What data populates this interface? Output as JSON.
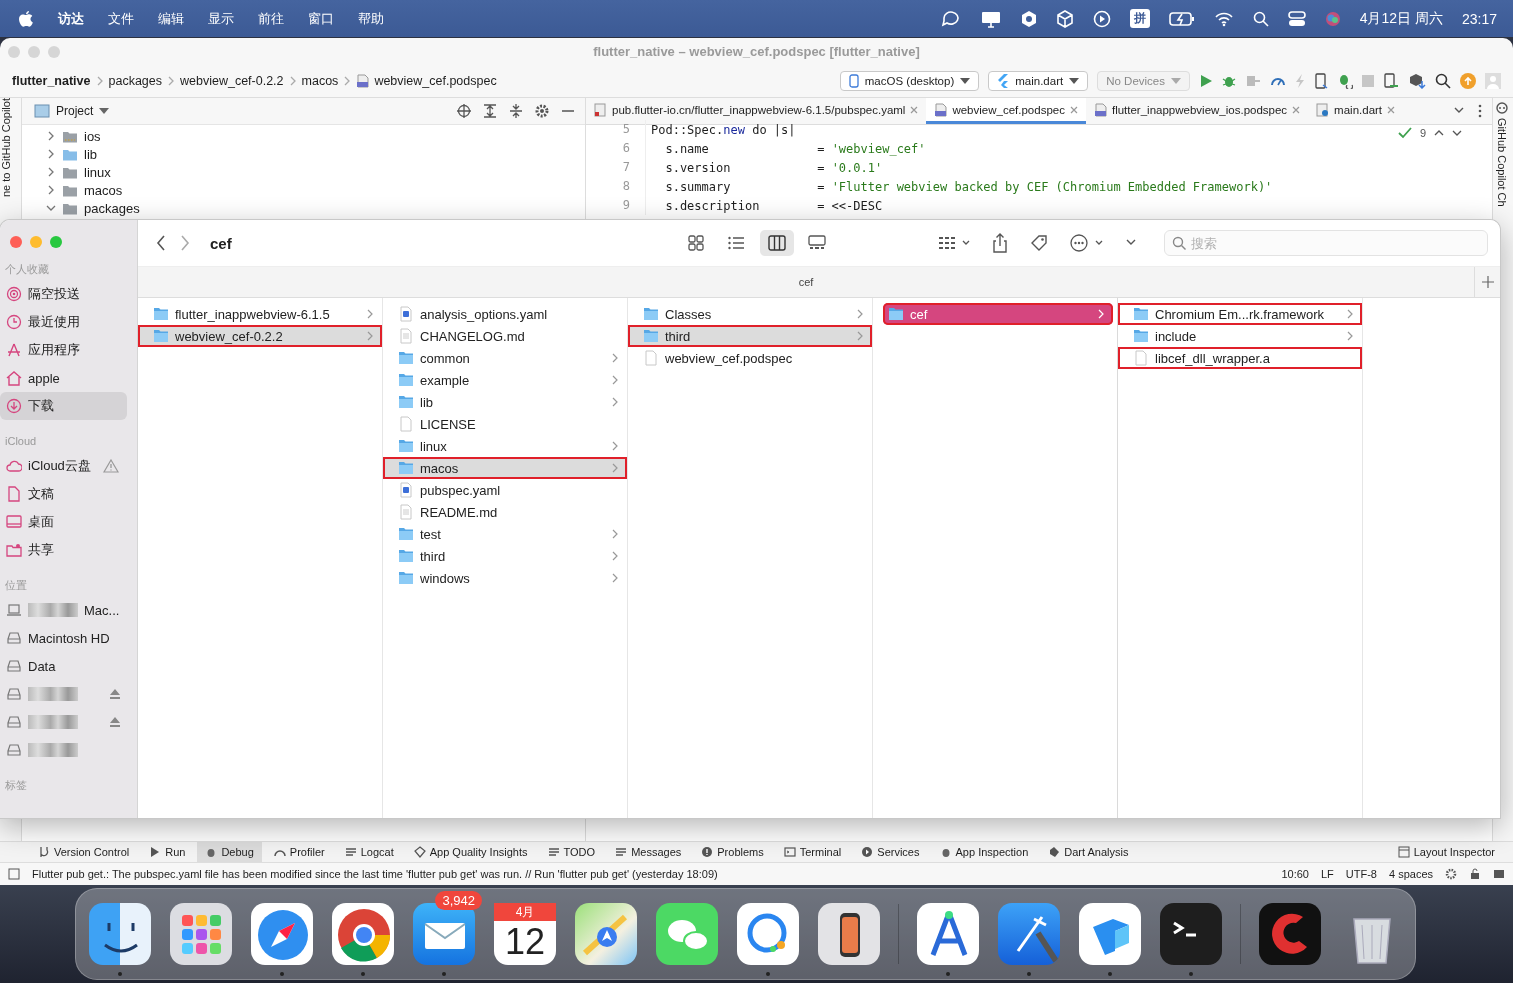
{
  "menubar": {
    "app": "访达",
    "menus": [
      "文件",
      "编辑",
      "显示",
      "前往",
      "窗口",
      "帮助"
    ],
    "input_method": "拼",
    "date": "4月12日 周六",
    "time": "23:17"
  },
  "ide": {
    "title": "flutter_native – webview_cef.podspec [flutter_native]",
    "breadcrumb": [
      "flutter_native",
      "packages",
      "webview_cef-0.2.2",
      "macos",
      "webview_cef.podspec"
    ],
    "run_config": {
      "device": "macOS (desktop)",
      "target": "main.dart",
      "devices": "No Devices"
    },
    "left_strip": "ne to GitHub Copilot",
    "right_strip": "GitHub Copilot Ch",
    "project": {
      "title": "Project",
      "tree": [
        {
          "label": "ios",
          "kind": "ios",
          "expanded": false
        },
        {
          "label": "lib",
          "kind": "source",
          "expanded": false
        },
        {
          "label": "linux",
          "kind": "folder",
          "expanded": false
        },
        {
          "label": "macos",
          "kind": "folder",
          "expanded": false
        },
        {
          "label": "packages",
          "kind": "folder",
          "expanded": true
        }
      ]
    },
    "tabs": [
      {
        "label": "pub.flutter-io.cn/flutter_inappwebview-6.1.5/pubspec.yaml",
        "kind": "yaml",
        "selected": false
      },
      {
        "label": "webview_cef.podspec",
        "kind": "podspec",
        "selected": true
      },
      {
        "label": "flutter_inappwebview_ios.podspec",
        "kind": "podspec",
        "selected": false
      },
      {
        "label": "main.dart",
        "kind": "dart",
        "selected": false
      }
    ],
    "problems_count": "9",
    "code": [
      {
        "line": "5",
        "parts": [
          {
            "t": "Pod::Spec.",
            "kind": "plain"
          },
          {
            "t": "new",
            "kind": "keyword"
          },
          {
            "t": " do |s|",
            "kind": "plain"
          }
        ]
      },
      {
        "line": "6",
        "parts": [
          {
            "t": "  s.name               = ",
            "kind": "plain"
          },
          {
            "t": "'webview_cef'",
            "kind": "string"
          }
        ]
      },
      {
        "line": "7",
        "parts": [
          {
            "t": "  s.version            = ",
            "kind": "plain"
          },
          {
            "t": "'0.0.1'",
            "kind": "string"
          }
        ]
      },
      {
        "line": "8",
        "parts": [
          {
            "t": "  s.summary            = ",
            "kind": "plain"
          },
          {
            "t": "'Flutter webview backed by CEF (Chromium Embedded Framework)'",
            "kind": "string"
          }
        ]
      },
      {
        "line": "9",
        "parts": [
          {
            "t": "  s.description        = <<-DESC",
            "kind": "plain"
          }
        ]
      }
    ],
    "tool_windows": [
      {
        "label": "Version Control",
        "kind": "vcs",
        "selected": false
      },
      {
        "label": "Run",
        "kind": "run",
        "selected": false
      },
      {
        "label": "Debug",
        "kind": "debug",
        "selected": true
      },
      {
        "label": "Profiler",
        "kind": "profiler",
        "selected": false
      },
      {
        "label": "Logcat",
        "kind": "list",
        "selected": false
      },
      {
        "label": "App Quality Insights",
        "kind": "diamond",
        "selected": false
      },
      {
        "label": "TODO",
        "kind": "list",
        "selected": false
      },
      {
        "label": "Messages",
        "kind": "list",
        "selected": false
      },
      {
        "label": "Problems",
        "kind": "info",
        "selected": false
      },
      {
        "label": "Terminal",
        "kind": "terminal",
        "selected": false
      },
      {
        "label": "Services",
        "kind": "play",
        "selected": false
      },
      {
        "label": "App Inspection",
        "kind": "debug",
        "selected": false
      },
      {
        "label": "Dart Analysis",
        "kind": "dart",
        "selected": false
      }
    ],
    "right_tool": "Layout Inspector",
    "status": {
      "message": "Flutter pub get.: The pubspec.yaml file has been modified since the last time 'flutter pub get' was run. // Run 'flutter pub get' (yesterday 18:09)",
      "position": "10:60",
      "line_separator": "LF",
      "encoding": "UTF-8",
      "indent": "4 spaces"
    }
  },
  "finder": {
    "title": "cef",
    "path_title": "cef",
    "search": {
      "placeholder": "搜索"
    },
    "view_modes": [
      {
        "kind": "icons",
        "selected": false
      },
      {
        "kind": "list",
        "selected": false
      },
      {
        "kind": "columns",
        "selected": true
      },
      {
        "kind": "gallery",
        "selected": false
      }
    ],
    "sidebar": [
      {
        "heading": "个人收藏",
        "items": [
          {
            "label": "隔空投送",
            "kind": "airdrop",
            "selected": false
          },
          {
            "label": "最近使用",
            "kind": "clock",
            "selected": false
          },
          {
            "label": "应用程序",
            "kind": "apps",
            "selected": false
          },
          {
            "label": "apple",
            "kind": "home",
            "selected": false
          },
          {
            "label": "下载",
            "kind": "download",
            "selected": true
          }
        ]
      },
      {
        "heading": "iCloud",
        "items": [
          {
            "label": "iCloud云盘",
            "kind": "cloud",
            "selected": false,
            "warning": true
          },
          {
            "label": "文稿",
            "kind": "doc",
            "selected": false
          },
          {
            "label": "桌面",
            "kind": "desktop",
            "selected": false
          },
          {
            "label": "共享",
            "kind": "shared",
            "selected": false
          }
        ]
      },
      {
        "heading": "位置",
        "items": [
          {
            "label": "Mac...",
            "kind": "laptop",
            "selected": false,
            "blurred": true
          },
          {
            "label": "Macintosh HD",
            "kind": "drive",
            "selected": false
          },
          {
            "label": "Data",
            "kind": "drive",
            "selected": false
          },
          {
            "kind": "drive",
            "selected": false,
            "blurred": true,
            "eject": true
          },
          {
            "kind": "drive",
            "selected": false,
            "blurred": true,
            "eject": true
          },
          {
            "kind": "drive",
            "selected": false,
            "blurred": true
          }
        ]
      },
      {
        "heading": "标签"
      }
    ],
    "columns": [
      {
        "active": false,
        "items": [
          {
            "name": "flutter_inappwebview-6.1.5",
            "kind": "folder",
            "selected": false,
            "annotated": false
          },
          {
            "name": "webview_cef-0.2.2",
            "kind": "folder",
            "selected": true,
            "annotated": true
          }
        ]
      },
      {
        "active": false,
        "items": [
          {
            "name": "analysis_options.yaml",
            "kind": "yaml",
            "selected": false,
            "annotated": false
          },
          {
            "name": "CHANGELOG.md",
            "kind": "text",
            "selected": false,
            "annotated": false
          },
          {
            "name": "common",
            "kind": "folder",
            "selected": false,
            "annotated": false
          },
          {
            "name": "example",
            "kind": "folder",
            "selected": false,
            "annotated": false
          },
          {
            "name": "lib",
            "kind": "folder",
            "selected": false,
            "annotated": false
          },
          {
            "name": "LICENSE",
            "kind": "file",
            "selected": false,
            "annotated": false
          },
          {
            "name": "linux",
            "kind": "folder",
            "selected": false,
            "annotated": false
          },
          {
            "name": "macos",
            "kind": "folder",
            "selected": true,
            "annotated": true
          },
          {
            "name": "pubspec.yaml",
            "kind": "yaml",
            "selected": false,
            "annotated": false
          },
          {
            "name": "README.md",
            "kind": "text",
            "selected": false,
            "annotated": false
          },
          {
            "name": "test",
            "kind": "folder",
            "selected": false,
            "annotated": false
          },
          {
            "name": "third",
            "kind": "folder",
            "selected": false,
            "annotated": false
          },
          {
            "name": "windows",
            "kind": "folder",
            "selected": false,
            "annotated": false
          }
        ]
      },
      {
        "active": false,
        "items": [
          {
            "name": "Classes",
            "kind": "folder",
            "selected": false,
            "annotated": false
          },
          {
            "name": "third",
            "kind": "folder",
            "selected": true,
            "annotated": true
          },
          {
            "name": "webview_cef.podspec",
            "kind": "file",
            "selected": false,
            "annotated": false
          }
        ]
      },
      {
        "active": true,
        "items": [
          {
            "name": "cef",
            "kind": "folder",
            "selected": true,
            "annotated": true
          }
        ]
      },
      {
        "active": false,
        "items": [
          {
            "name": "Chromium Em...rk.framework",
            "kind": "folder",
            "selected": false,
            "annotated": true
          },
          {
            "name": "include",
            "kind": "folder",
            "selected": false,
            "annotated": false
          },
          {
            "name": "libcef_dll_wrapper.a",
            "kind": "file",
            "selected": false,
            "annotated": true
          }
        ]
      }
    ]
  },
  "dock": {
    "apps": [
      {
        "kind": "finder",
        "running": true
      },
      {
        "kind": "launchpad"
      },
      {
        "kind": "safari",
        "running": true
      },
      {
        "kind": "chrome",
        "running": true
      },
      {
        "kind": "mail",
        "running": true,
        "badge": "3,942"
      },
      {
        "kind": "calendar",
        "month": "4月",
        "day": "12"
      },
      {
        "kind": "maps"
      },
      {
        "kind": "wechat"
      },
      {
        "kind": "chat",
        "running": true
      },
      {
        "kind": "phone"
      },
      {
        "kind": "separator"
      },
      {
        "kind": "studio",
        "running": true
      },
      {
        "kind": "xcode",
        "running": true
      },
      {
        "kind": "blueapp",
        "running": true
      },
      {
        "kind": "terminal",
        "running": true
      },
      {
        "kind": "separator"
      },
      {
        "kind": "redapp"
      },
      {
        "kind": "trash"
      }
    ]
  }
}
